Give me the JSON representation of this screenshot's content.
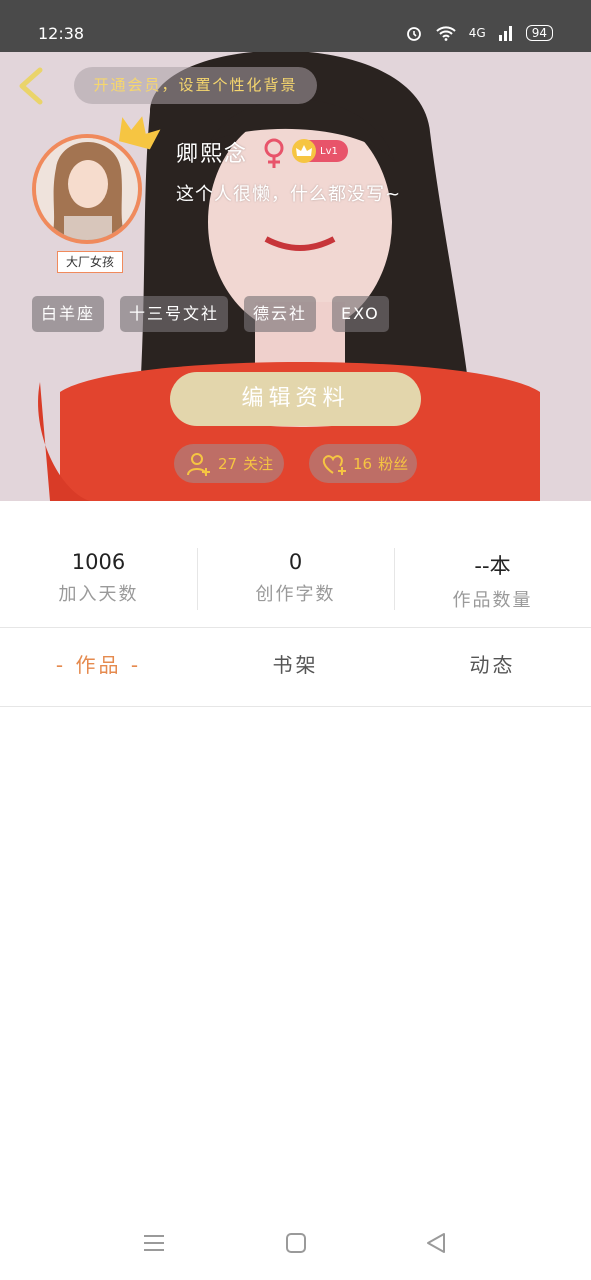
{
  "status_bar": {
    "time": "12:38",
    "network": "4G",
    "battery": "94"
  },
  "header": {
    "promo_text": "开通会员，设置个性化背景"
  },
  "profile": {
    "avatar_badge": "大厂女孩",
    "username": "卿熙念",
    "level": "Lv1",
    "bio": "这个人很懒，什么都没写~",
    "tags": [
      "白羊座",
      "十三号文社",
      "德云社",
      "EXO"
    ],
    "edit_button": "编辑资料",
    "follow_count": "27",
    "follow_label": "关注",
    "fans_count": "16",
    "fans_label": "粉丝"
  },
  "stats": [
    {
      "value": "1006",
      "label": "加入天数"
    },
    {
      "value": "0",
      "label": "创作字数"
    },
    {
      "value": "--本",
      "label": "作品数量"
    }
  ],
  "tabs": [
    {
      "label": "作品",
      "active": true
    },
    {
      "label": "书架",
      "active": false
    },
    {
      "label": "动态",
      "active": false
    }
  ],
  "colors": {
    "accent": "#e58a4e",
    "gold": "#f6c542",
    "edit_button": "#e3d6ac",
    "level_badge": "#e8546a"
  },
  "icons": {
    "back": "chevron-left-icon",
    "crown": "crown-icon",
    "gender": "female-icon",
    "follow": "add-user-icon",
    "fans": "heart-plus-icon",
    "nav_menu": "menu-icon",
    "nav_home": "square-icon",
    "nav_back": "triangle-back-icon"
  }
}
